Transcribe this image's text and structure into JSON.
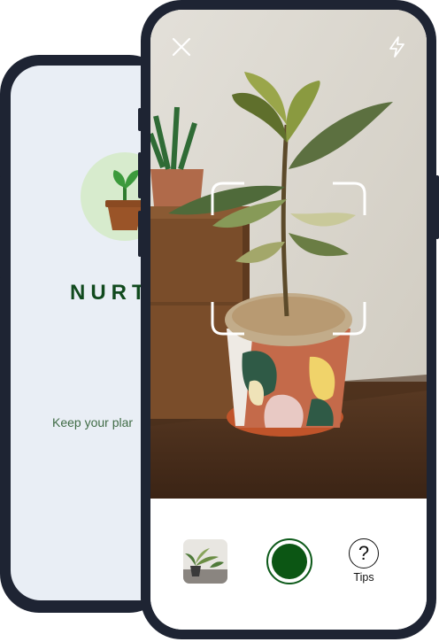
{
  "welcome_screen": {
    "brand": "NURT",
    "tagline": "Keep your plar"
  },
  "camera_screen": {
    "close_icon": "close-icon",
    "flash_icon": "flash-icon",
    "gallery_icon": "gallery-thumbnail",
    "capture_icon": "shutter-button",
    "tips_icon": "?",
    "tips_label": "Tips"
  },
  "colors": {
    "brand_green": "#114a1e",
    "shutter_green": "#0c5614",
    "phone_frame": "#1e2433",
    "welcome_bg": "#e9eef5"
  }
}
